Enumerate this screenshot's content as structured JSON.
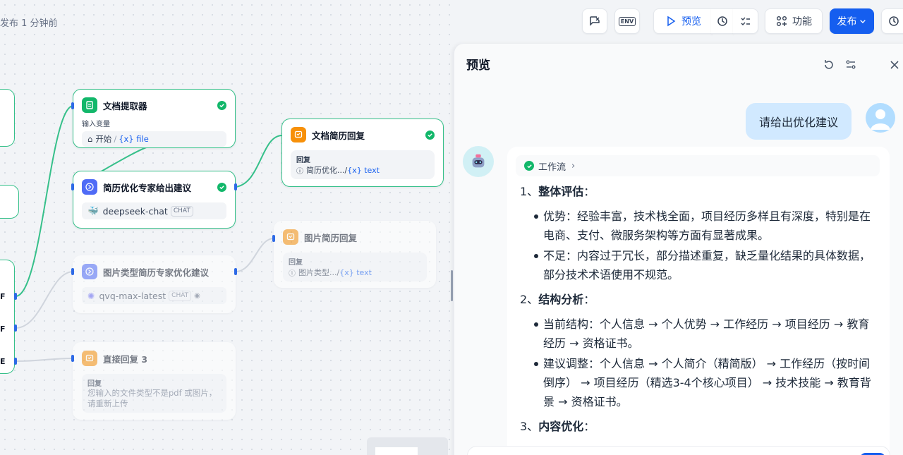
{
  "header": {
    "publish_status": "发布 1 分钟前",
    "preview_label": "预览",
    "features_label": "功能",
    "publish_label": "发布",
    "env_label": "ENV"
  },
  "nodes": {
    "doc_extractor": {
      "title": "文档提取器",
      "sub": "输入变量",
      "src": "开始",
      "var": "{x} file"
    },
    "resume_expert": {
      "title": "简历优化专家给出建议",
      "model": "deepseek-chat",
      "tag": "CHAT"
    },
    "img_expert": {
      "title": "图片类型简历专家优化建议",
      "model": "qvq-max-latest",
      "tag": "CHAT"
    },
    "doc_reply": {
      "title": "文档简历回复",
      "label": "回复",
      "src": "简历优化...",
      "var": "{x} text"
    },
    "img_reply": {
      "title": "图片简历回复",
      "label": "回复",
      "src": "图片类型...",
      "var": "{x} text"
    },
    "direct_reply": {
      "title": "直接回复 3",
      "label": "回复",
      "text": "您输入的文件类型不是pdf 或图片，请重新上传"
    }
  },
  "left_partial_letters": [
    "F",
    "F",
    "E"
  ],
  "panel": {
    "title": "预览",
    "user_message": "请给出优化建议",
    "workflow_chip": "工作流",
    "answer": {
      "s1_prefix": "1、",
      "s1_title": "整体评估",
      "s1_colon": "：",
      "s1_items": [
        "优势：经验丰富，技术栈全面，项目经历多样且有深度，特别是在电商、支付、微服务架构等方面有显著成果。",
        "不足：内容过于冗长，部分描述重复，缺乏量化结果的具体数据，部分技术术语使用不规范。"
      ],
      "s2_prefix": "2、",
      "s2_title": "结构分析",
      "s2_colon": "：",
      "s2_items": [
        "当前结构：个人信息 → 个人优势 → 工作经历 → 项目经历 → 教育经历 → 资格证书。",
        "建议调整：个人信息 → 个人简介（精简版） → 工作经历（按时间倒序） → 项目经历（精选3-4个核心项目） → 技术技能 → 教育背景 → 资格证书。"
      ],
      "s3_prefix": "3、",
      "s3_title": "内容优化",
      "s3_colon": "："
    }
  },
  "colors": {
    "accent": "#155eef",
    "success": "#12b76a",
    "bubble": "#d1e9ff"
  }
}
